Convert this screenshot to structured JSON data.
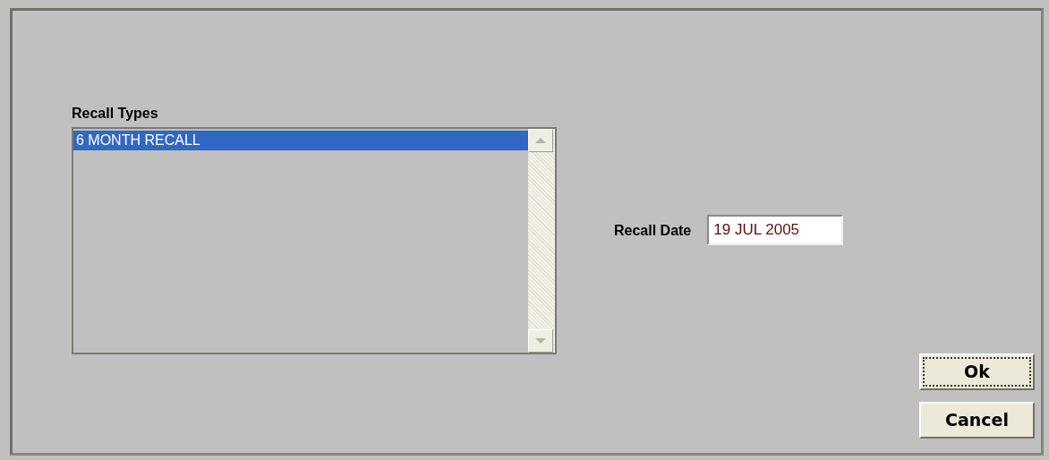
{
  "recall_types": {
    "label": "Recall Types",
    "items": [
      {
        "text": "6 MONTH RECALL",
        "selected": true
      }
    ]
  },
  "recall_date": {
    "label": "Recall Date",
    "value": "19 JUL 2005"
  },
  "buttons": [
    {
      "label": "Ok",
      "focused": true
    },
    {
      "label": "Cancel",
      "focused": false
    }
  ]
}
